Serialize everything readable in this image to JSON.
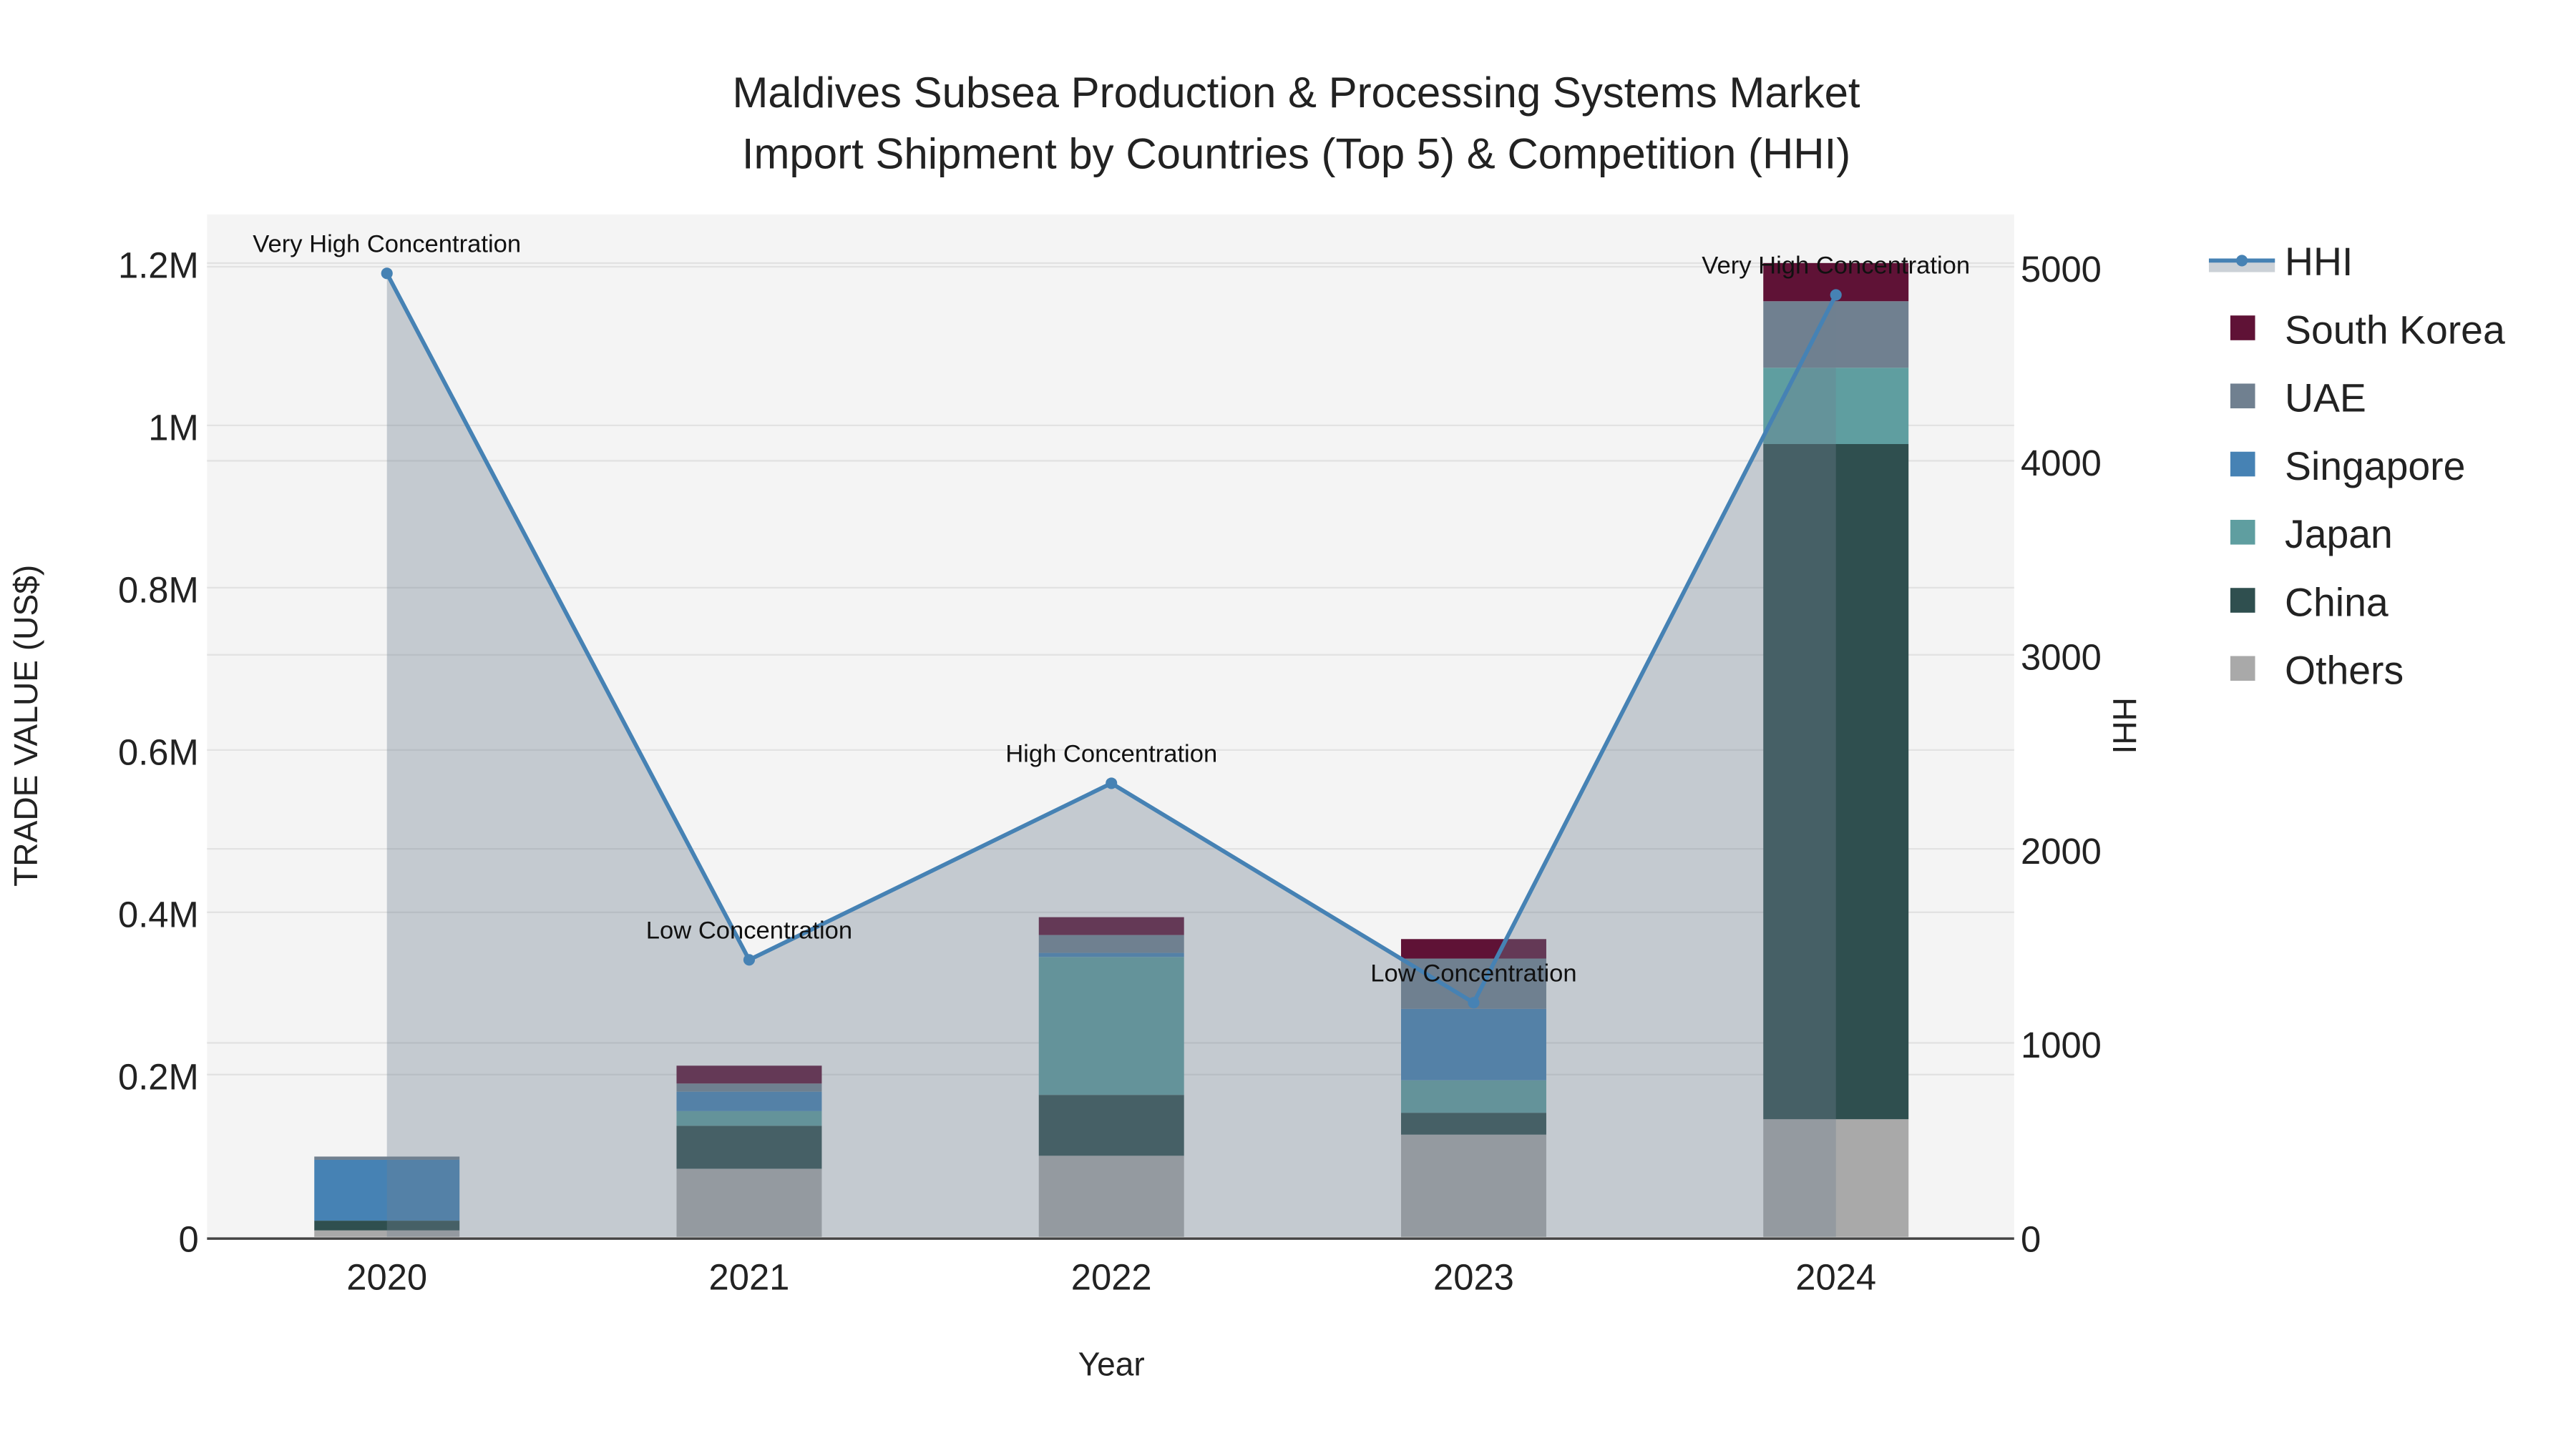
{
  "chart_data": {
    "type": "bar",
    "title_line1": "Maldives Subsea Production & Processing Systems Market",
    "title_line2": "Import Shipment by Countries (Top 5) & Competition (HHI)",
    "xlabel": "Year",
    "ylabel": "TRADE VALUE (US$)",
    "y2label": "HHI",
    "categories": [
      "2020",
      "2021",
      "2022",
      "2023",
      "2024"
    ],
    "ylim": [
      0,
      1260000
    ],
    "y2lim": [
      0,
      5270
    ],
    "yticks": [
      {
        "v": 0,
        "label": "0"
      },
      {
        "v": 200000,
        "label": "0.2M"
      },
      {
        "v": 400000,
        "label": "0.4M"
      },
      {
        "v": 600000,
        "label": "0.6M"
      },
      {
        "v": 800000,
        "label": "0.8M"
      },
      {
        "v": 1000000,
        "label": "1M"
      },
      {
        "v": 1200000,
        "label": "1.2M"
      }
    ],
    "y2ticks": [
      {
        "v": 0,
        "label": "0"
      },
      {
        "v": 1000,
        "label": "1000"
      },
      {
        "v": 2000,
        "label": "2000"
      },
      {
        "v": 3000,
        "label": "3000"
      },
      {
        "v": 4000,
        "label": "4000"
      },
      {
        "v": 5000,
        "label": "5000"
      }
    ],
    "series": [
      {
        "name": "Others",
        "color": "#a9a9a9",
        "values": [
          8000,
          84000,
          100000,
          126000,
          145000
        ]
      },
      {
        "name": "China",
        "color": "#2f4f4f",
        "values": [
          12000,
          53000,
          75000,
          27000,
          832000
        ]
      },
      {
        "name": "Japan",
        "color": "#5f9ea0",
        "values": [
          0,
          18000,
          170000,
          40000,
          94000
        ]
      },
      {
        "name": "Singapore",
        "color": "#4682b4",
        "values": [
          75000,
          24000,
          5000,
          88000,
          0
        ]
      },
      {
        "name": "UAE",
        "color": "#708090",
        "values": [
          4000,
          10000,
          22000,
          62000,
          82000
        ]
      },
      {
        "name": "South Korea",
        "color": "#5f1236",
        "values": [
          0,
          22000,
          22000,
          24000,
          47000
        ]
      }
    ],
    "hhi": {
      "name": "HHI",
      "color": "#4682b4",
      "values": [
        4966,
        1428,
        2338,
        1207,
        4855
      ]
    },
    "annotations": [
      "Very High Concentration",
      "Low Concentration",
      "High Concentration",
      "Low Concentration",
      "Very High Concentration"
    ],
    "legend": [
      "HHI",
      "South Korea",
      "UAE",
      "Singapore",
      "Japan",
      "China",
      "Others"
    ],
    "legend_position": "right",
    "grid": true
  }
}
